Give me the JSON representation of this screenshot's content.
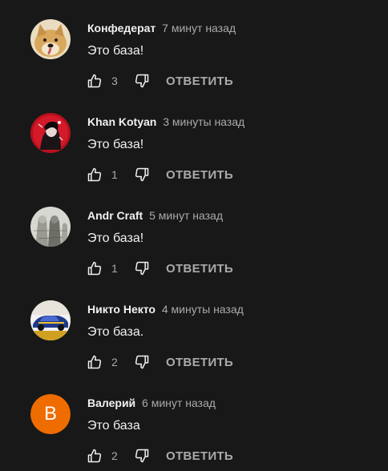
{
  "colors": {
    "background": "#181818",
    "text_primary": "#f1f1f1",
    "text_secondary": "#aaaaaa",
    "avatar_letter_bg": "#ef6c00"
  },
  "comments": [
    {
      "author": "Конфедерат",
      "time": "7 минут назад",
      "text": "Это база!",
      "likes": "3",
      "reply_label": "ОТВЕТИТЬ",
      "avatar": "doge-avatar"
    },
    {
      "author": "Khan Kotyan",
      "time": "3 минуты назад",
      "text": "Это база!",
      "likes": "1",
      "reply_label": "ОТВЕТИТЬ",
      "avatar": "anime-avatar"
    },
    {
      "author": "Andr Craft",
      "time": "5 минут назад",
      "text": "Это база!",
      "likes": "1",
      "reply_label": "ОТВЕТИТЬ",
      "avatar": "sketch-avatar"
    },
    {
      "author": "Никто Некто",
      "time": "4 минуты назад",
      "text": "Это база.",
      "likes": "2",
      "reply_label": "ОТВЕТИТЬ",
      "avatar": "car-avatar"
    },
    {
      "author": "Валерий",
      "time": "6 минут назад",
      "text": "Это база",
      "likes": "2",
      "reply_label": "ОТВЕТИТЬ",
      "avatar": "letter-avatar",
      "avatar_letter": "В"
    }
  ]
}
